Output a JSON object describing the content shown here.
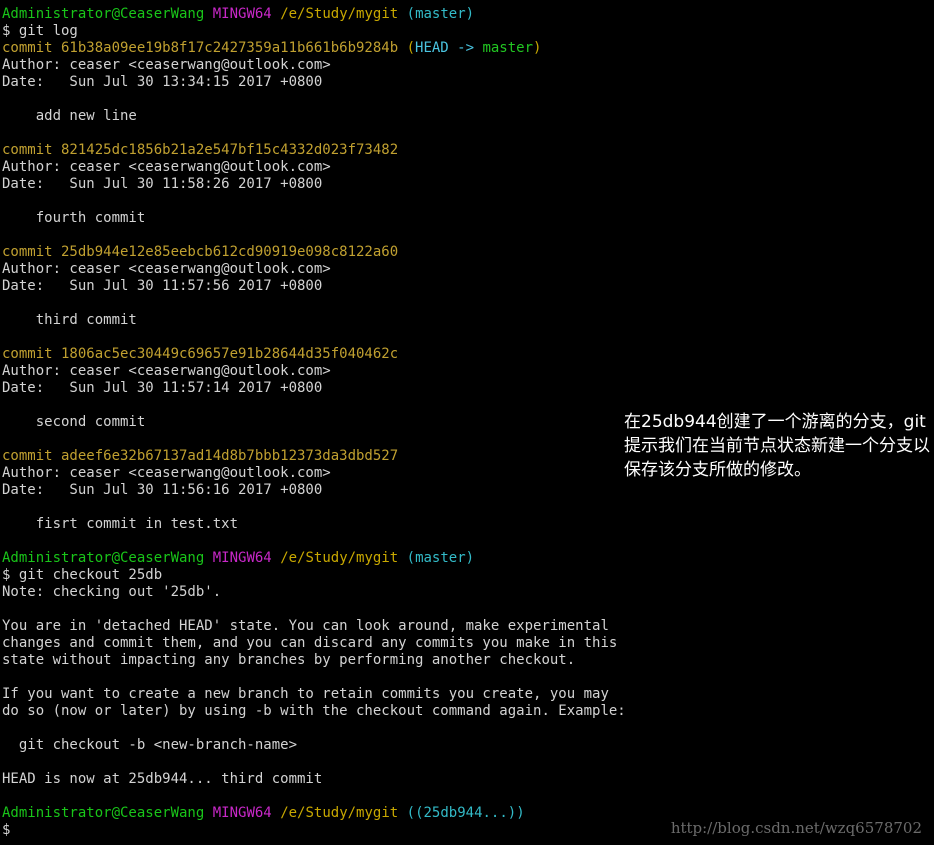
{
  "prompt1": {
    "user": "Administrator@CeaserWang",
    "env": "MINGW64",
    "path": "/e/Study/mygit",
    "branch": "(master)"
  },
  "cmd1": "$ git log",
  "commits": [
    {
      "hash": "commit 61b38a09ee19b8f17c2427359a11b661b6b9284b",
      "refs_open": " (",
      "refs_head": "HEAD -> ",
      "refs_master": "master",
      "refs_close": ")",
      "author": "Author: ceaser <ceaserwang@outlook.com>",
      "date": "Date:   Sun Jul 30 13:34:15 2017 +0800",
      "message": "    add new line"
    },
    {
      "hash": "commit 821425dc1856b21a2e547bf15c4332d023f73482",
      "author": "Author: ceaser <ceaserwang@outlook.com>",
      "date": "Date:   Sun Jul 30 11:58:26 2017 +0800",
      "message": "    fourth commit"
    },
    {
      "hash": "commit 25db944e12e85eebcb612cd90919e098c8122a60",
      "author": "Author: ceaser <ceaserwang@outlook.com>",
      "date": "Date:   Sun Jul 30 11:57:56 2017 +0800",
      "message": "    third commit"
    },
    {
      "hash": "commit 1806ac5ec30449c69657e91b28644d35f040462c",
      "author": "Author: ceaser <ceaserwang@outlook.com>",
      "date": "Date:   Sun Jul 30 11:57:14 2017 +0800",
      "message": "    second commit"
    },
    {
      "hash": "commit adeef6e32b67137ad14d8b7bbb12373da3dbd527",
      "author": "Author: ceaser <ceaserwang@outlook.com>",
      "date": "Date:   Sun Jul 30 11:56:16 2017 +0800",
      "message": "    fisrt commit in test.txt"
    }
  ],
  "prompt2": {
    "user": "Administrator@CeaserWang",
    "env": "MINGW64",
    "path": "/e/Study/mygit",
    "branch": "(master)"
  },
  "cmd2": "$ git checkout 25db",
  "checkout_output": [
    "Note: checking out '25db'.",
    "",
    "You are in 'detached HEAD' state. You can look around, make experimental",
    "changes and commit them, and you can discard any commits you make in this",
    "state without impacting any branches by performing another checkout.",
    "",
    "If you want to create a new branch to retain commits you create, you may",
    "do so (now or later) by using -b with the checkout command again. Example:",
    "",
    "  git checkout -b <new-branch-name>",
    "",
    "HEAD is now at 25db944... third commit"
  ],
  "prompt3": {
    "user": "Administrator@CeaserWang",
    "env": "MINGW64",
    "path": "/e/Study/mygit",
    "branch": "((25db944...))"
  },
  "cmd3": "$",
  "annotation": "在25db944创建了一个游离的分支，git提示我们在当前节点状态新建一个分支以保存该分支所做的修改。",
  "watermark": "http://blog.csdn.net/wzq6578702",
  "colors": {
    "user": "#19c519",
    "env": "#c828c8",
    "path": "#c8a800",
    "branch": "#33bbc8",
    "text": "#d3d3d3",
    "background": "#000000"
  }
}
